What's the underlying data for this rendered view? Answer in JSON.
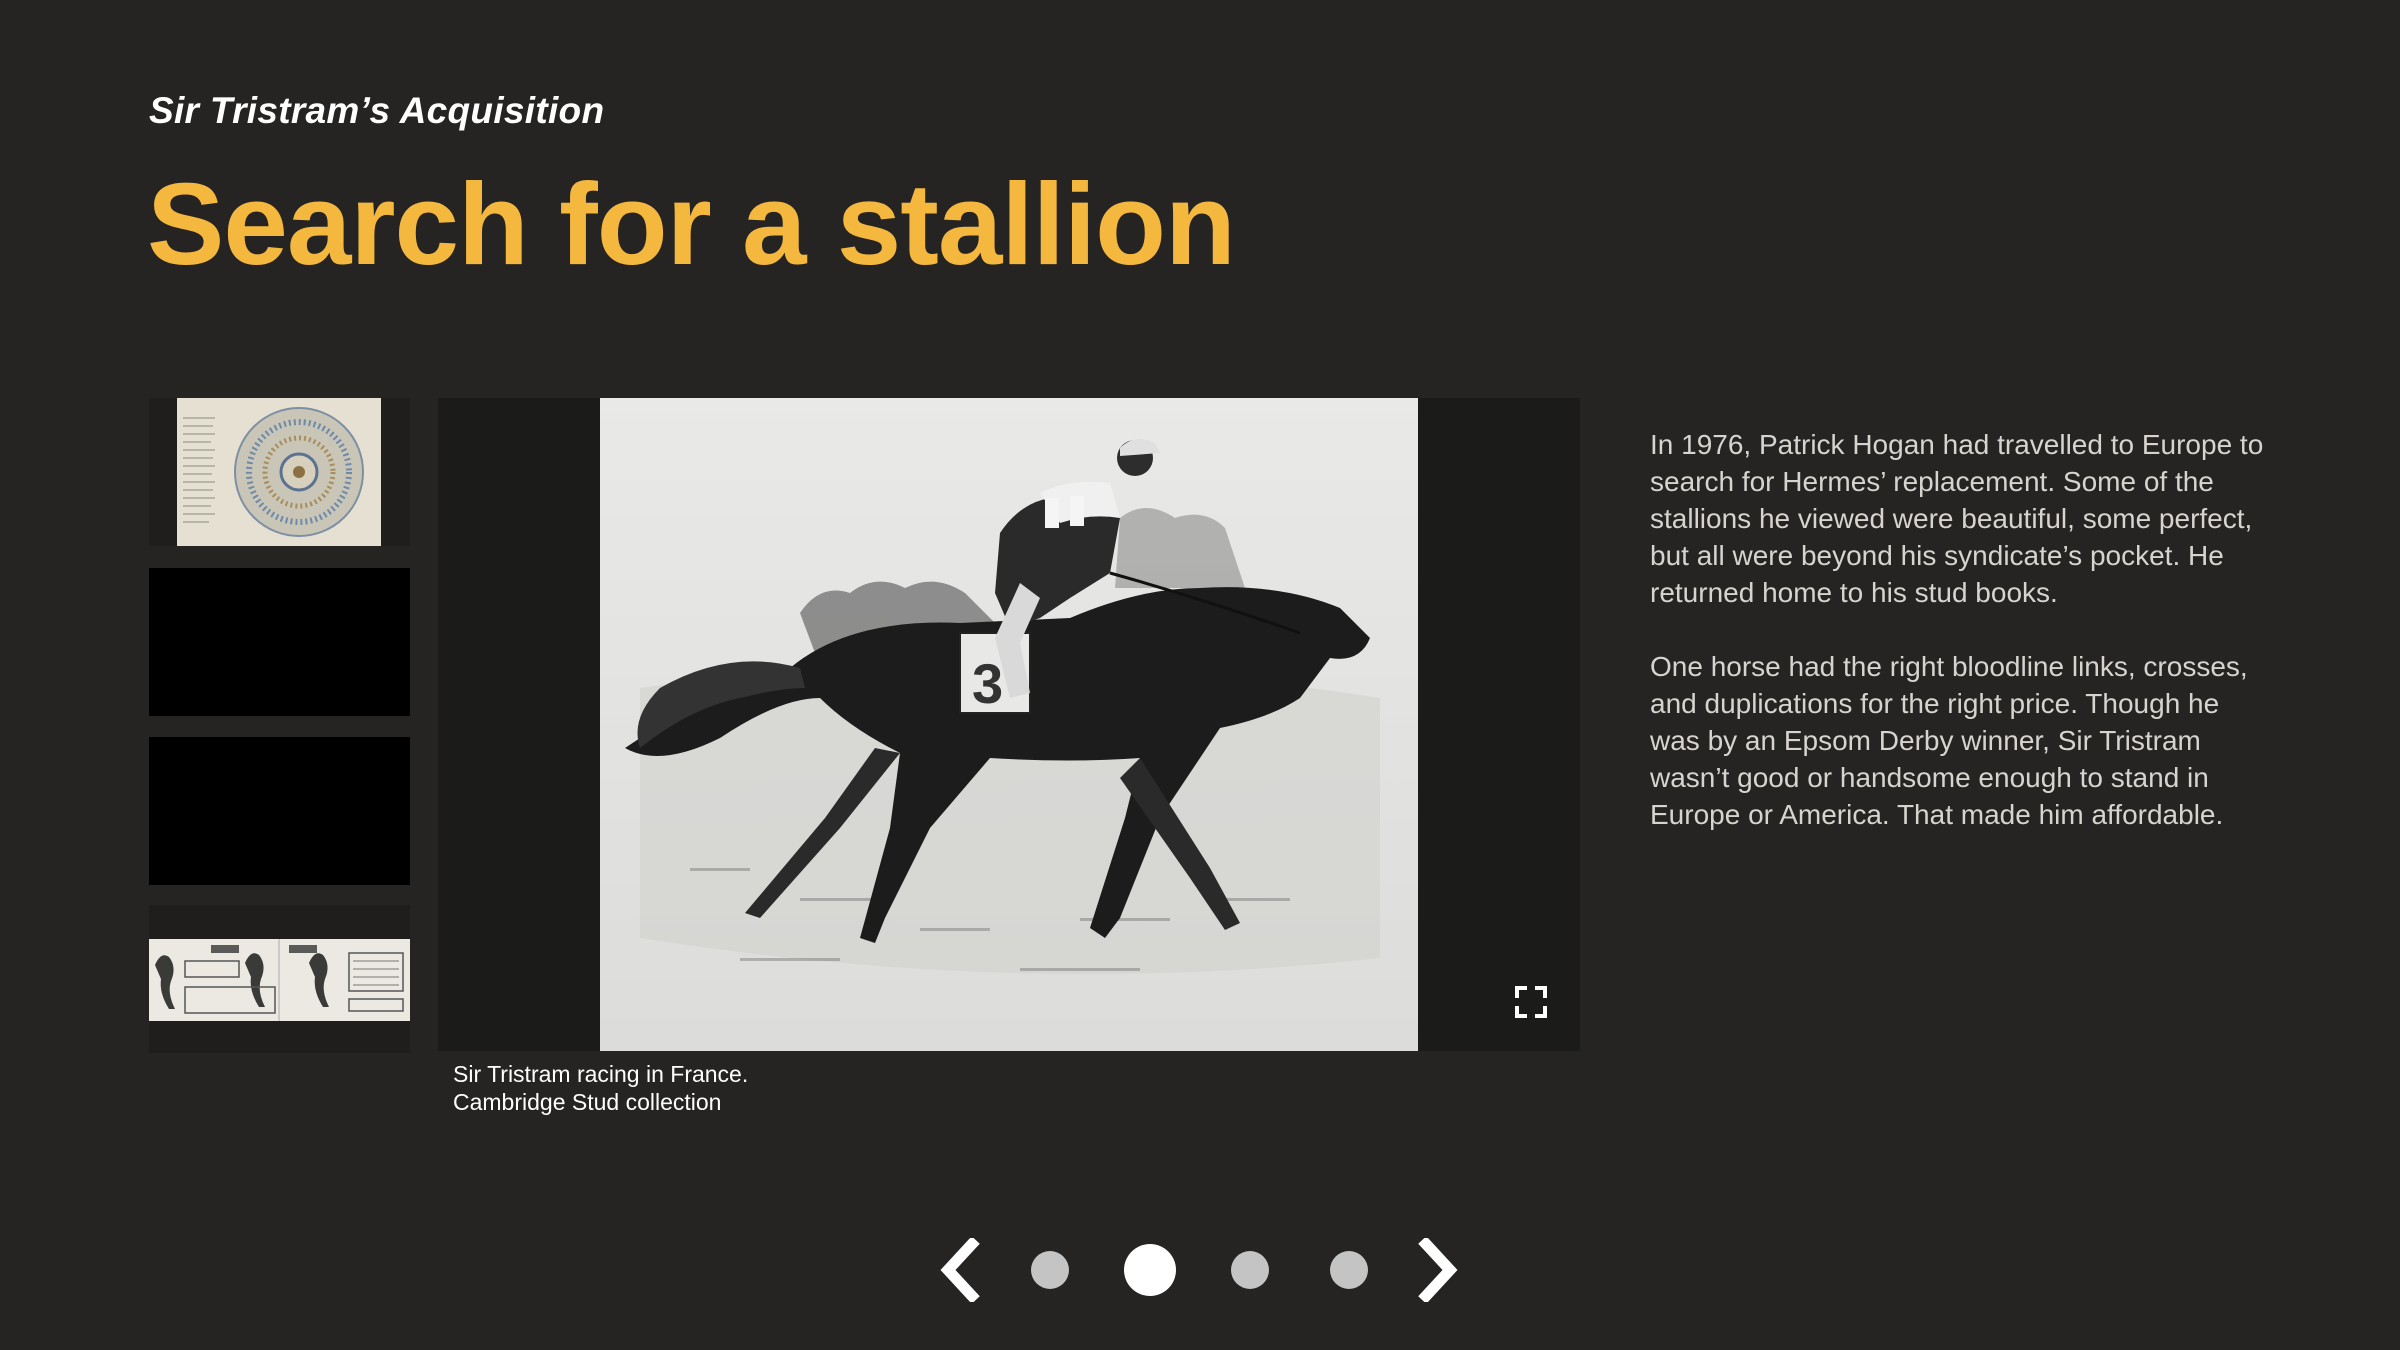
{
  "header": {
    "subtitle": "Sir Tristram’s Acquisition",
    "title": "Search for a stallion"
  },
  "gallery": {
    "thumbnails": [
      {
        "icon": "pedigree-chart-thumbnail",
        "selected": false
      },
      {
        "icon": "blank-thumbnail",
        "selected": false
      },
      {
        "icon": "blank-thumbnail",
        "selected": false
      },
      {
        "icon": "racing-sheet-thumbnail",
        "selected": false
      }
    ],
    "main_image": {
      "icon": "horse-racing-photo",
      "saddlecloth_number": "3"
    },
    "caption_line1": "Sir Tristram racing in France.",
    "caption_line2": "Cambridge Stud collection",
    "fullscreen_icon": "fullscreen-icon"
  },
  "body": {
    "paragraph1": "In 1976, Patrick Hogan had travelled to Europe to search for Hermes’ replacement. Some of the stallions he viewed were beautiful, some perfect, but all were beyond his syndicate’s pocket. He returned home to his stud books.",
    "paragraph2": "One horse had the right bloodline links, crosses, and duplications for the right price. Though he was by an Epsom Derby winner, Sir Tristram wasn’t good or handsome enough to stand in Europe or America. That made him affordable."
  },
  "pagination": {
    "prev_icon": "chevron-left-icon",
    "next_icon": "chevron-right-icon",
    "total_pages": 4,
    "current_page": 2
  },
  "colors": {
    "background": "#252422",
    "accent": "#f4b83f",
    "text": "#d7d4cf"
  }
}
